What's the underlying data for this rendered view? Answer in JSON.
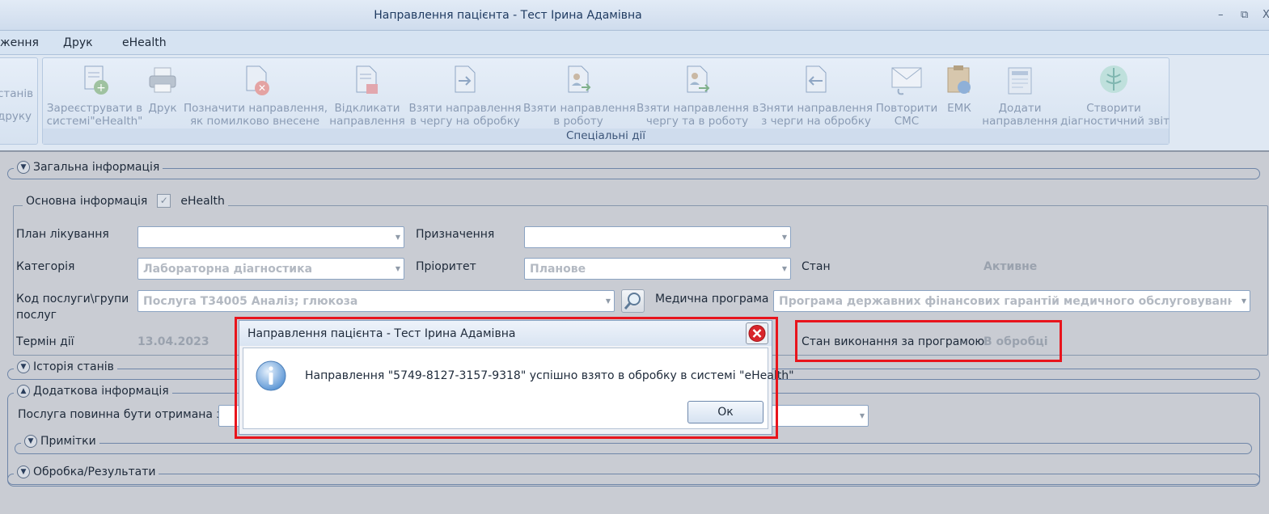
{
  "window": {
    "title": "Направлення пацієнта - Тест Ірина Адамівна",
    "minimize": "–",
    "restore": "⧉",
    "close": "X"
  },
  "menu": {
    "items": [
      "ження",
      "Друк",
      "eHealth"
    ]
  },
  "ribbon": {
    "left_partial": [
      "станів",
      "друку"
    ],
    "group_label": "Спеціальні дії",
    "buttons": [
      {
        "label": "Зареєструвати в\nсистемі\"eHealth\"",
        "icon": "register-doc-icon"
      },
      {
        "label": "Друк",
        "icon": "printer-icon"
      },
      {
        "label": "Позначити направлення,\nяк помилково внесене",
        "icon": "mark-error-icon"
      },
      {
        "label": "Відкликати\nнаправлення",
        "icon": "recall-doc-icon"
      },
      {
        "label": "Взяти направлення\nв чергу на обробку",
        "icon": "queue-doc-icon"
      },
      {
        "label": "Взяти направлення\nв роботу",
        "icon": "take-work-icon"
      },
      {
        "label": "Взяти направлення в\nчергу та в роботу",
        "icon": "queue-work-icon"
      },
      {
        "label": "Зняти направлення\nз черги на обробку",
        "icon": "remove-queue-icon"
      },
      {
        "label": "Повторити\nСМС",
        "icon": "sms-icon"
      },
      {
        "label": "ЕМК",
        "icon": "emk-icon"
      },
      {
        "label": "Додати\nнаправлення",
        "icon": "add-referral-icon"
      },
      {
        "label": "Створити\nдіагностичний звіт",
        "icon": "diagnostic-report-icon"
      }
    ]
  },
  "form": {
    "general_info": "Загальна інформація",
    "basic_info": "Основна інформація",
    "ehealth_label": "eHealth",
    "ehealth_checked": "✓",
    "treatment_plan_label": "План лікування",
    "treatment_plan_value": "",
    "purpose_label": "Призначення",
    "purpose_value": "",
    "category_label": "Категорія",
    "category_value": "Лабораторна діагностика",
    "priority_label": "Пріоритет",
    "priority_value": "Планове",
    "state_label": "Стан",
    "state_value": "Активне",
    "service_code_label_1": "Код послуги\\групи",
    "service_code_label_2": "послуг",
    "service_code_value": "Послуга Т34005 Аналіз; глюкоза",
    "med_program_label": "Медична програма",
    "med_program_value": "Програма державних фінансових гарантій медичного обслуговування насел",
    "term_label": "Термін дії",
    "term_value": "13.04.2023",
    "program_state_label": "Стан виконання за програмою",
    "program_state_value": "В обробці",
    "history": "Історія станів",
    "additional": "Додаткова інформація",
    "service_received_label": "Послуга повинна бути отримана з",
    "notes": "Примітки",
    "processing": "Обробка/Результати"
  },
  "dialog": {
    "title": "Направлення пацієнта - Тест Ірина Адамівна",
    "message": "Направлення \"5749-8127-3157-9318\" успішно взято в обробку в системі \"eHealth\"",
    "ok": "Ок"
  }
}
